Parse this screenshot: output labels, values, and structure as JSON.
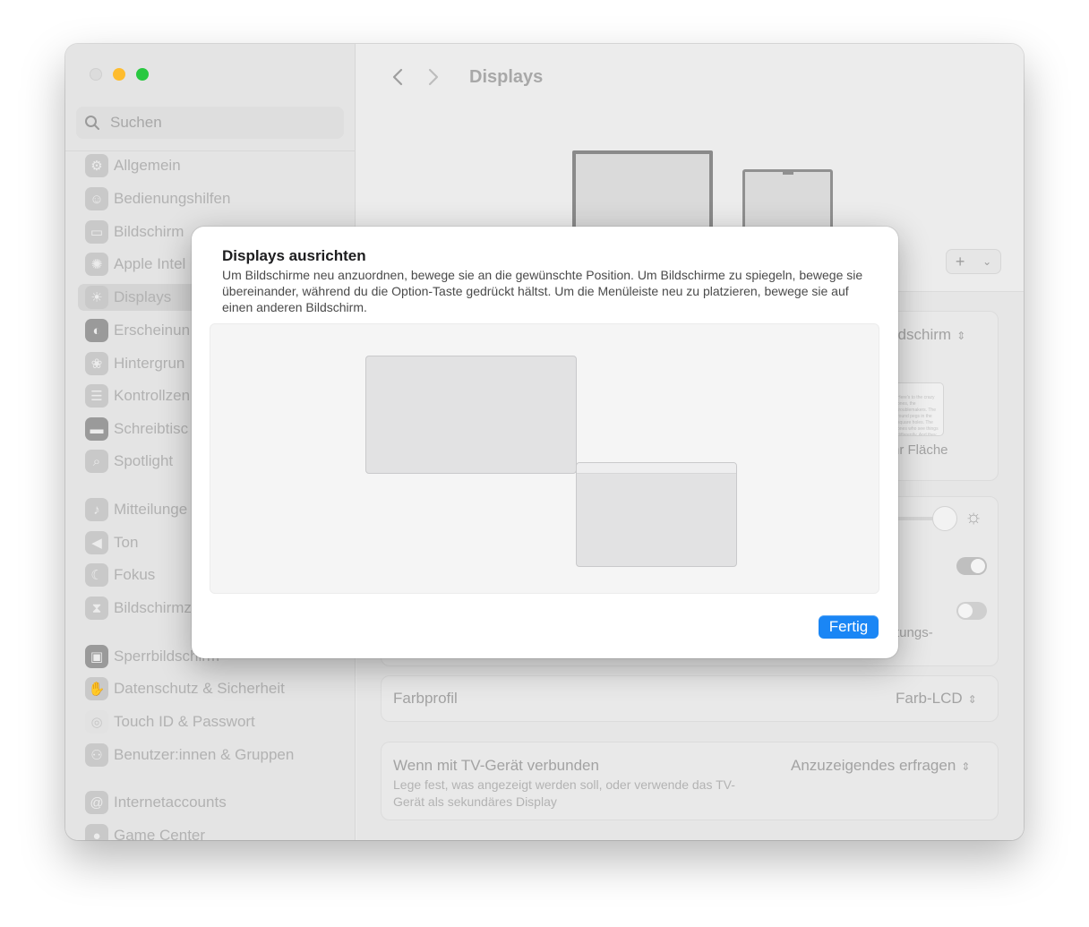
{
  "window": {
    "title": "Displays"
  },
  "search": {
    "placeholder": "Suchen"
  },
  "sidebar": {
    "items": [
      {
        "label": "Allgemein",
        "icon": "gear-icon"
      },
      {
        "label": "Bedienungshilfen",
        "icon": "accessibility-icon"
      },
      {
        "label": "Bildschirm",
        "icon": "screen-icon"
      },
      {
        "label": "Apple Intel",
        "icon": "apple-intelligence-icon"
      },
      {
        "label": "Displays",
        "icon": "sun-icon",
        "selected": true
      },
      {
        "label": "Erscheinun",
        "icon": "appearance-icon"
      },
      {
        "label": "Hintergrun",
        "icon": "wallpaper-icon"
      },
      {
        "label": "Kontrollzen",
        "icon": "control-center-icon"
      },
      {
        "label": "Schreibtisc",
        "icon": "desktop-icon"
      },
      {
        "label": "Spotlight",
        "icon": "magnifier-icon"
      },
      {
        "label": "Mitteilunge",
        "icon": "bell-icon"
      },
      {
        "label": "Ton",
        "icon": "speaker-icon"
      },
      {
        "label": "Fokus",
        "icon": "moon-icon"
      },
      {
        "label": "Bildschirmz",
        "icon": "hourglass-icon"
      },
      {
        "label": "Sperrbildschirm",
        "icon": "lock-icon"
      },
      {
        "label": "Datenschutz & Sicherheit",
        "icon": "hand-icon"
      },
      {
        "label": "Touch ID & Passwort",
        "icon": "fingerprint-icon"
      },
      {
        "label": "Benutzer:innen & Gruppen",
        "icon": "users-icon"
      },
      {
        "label": "Internetaccounts",
        "icon": "at-icon"
      },
      {
        "label": "Game Center",
        "icon": "game-center-icon"
      }
    ]
  },
  "main": {
    "add_symbol": "+",
    "main_display_value": "ildschirm",
    "more_space_label": "hr Fläche",
    "thumb_text": "Here's to the crazy ones, the troublemakers. The round pegs in the square holes. The ones who see things differently. And they have no respect for the status quo. You can quote them, disagree with them. About the only thing you can't do is ignore them. Because they change things.",
    "partial_label": "tungs-",
    "color_profile": {
      "label": "Farbprofil",
      "value": "Farb-LCD"
    },
    "tv": {
      "label": "Wenn mit TV-Gerät verbunden",
      "value": "Anzuzeigendes erfragen",
      "sublabel": "Lege fest, was angezeigt werden soll, oder verwende das TV-Gerät als sekundäres Display"
    }
  },
  "modal": {
    "title": "Displays ausrichten",
    "description": "Um Bildschirme neu anzuordnen, bewege sie an die gewünschte Position. Um Bildschirme zu spiegeln, bewege sie übereinander, während du die Option-Taste gedrückt hältst. Um die Menüleiste neu zu platzieren, bewege sie auf einen anderen Bildschirm.",
    "done_label": "Fertig"
  },
  "colors": {
    "accent": "#1a86f5",
    "close": "#dcdcdc",
    "minimize": "#febc2e",
    "maximize": "#28c840"
  }
}
